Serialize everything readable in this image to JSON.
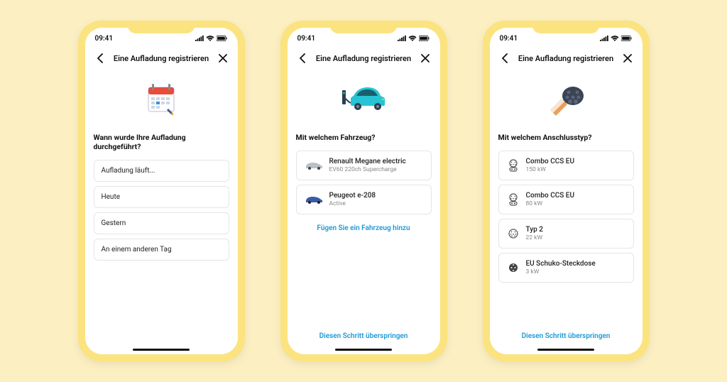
{
  "status": {
    "time": "09:41"
  },
  "nav": {
    "title": "Eine Aufladung registrieren"
  },
  "screen1": {
    "question": "Wann wurde Ihre Aufladung durchgeführt?",
    "options": [
      "Aufladung läuft...",
      "Heute",
      "Gestern",
      "An einem anderen Tag"
    ]
  },
  "screen2": {
    "question": "Mit welchem Fahrzeug?",
    "vehicles": [
      {
        "name": "Renault Megane electric",
        "sub": "EV60 220ch Supercharge"
      },
      {
        "name": "Peugeot e-208",
        "sub": "Active"
      }
    ],
    "add_link": "Fügen Sie ein Fahrzeug hinzu",
    "skip": "Diesen Schritt überspringen"
  },
  "screen3": {
    "question": "Mit welchem Anschlusstyp?",
    "connectors": [
      {
        "name": "Combo CCS EU",
        "sub": "150 kW"
      },
      {
        "name": "Combo CCS EU",
        "sub": "80 kW"
      },
      {
        "name": "Typ 2",
        "sub": "22 kW"
      },
      {
        "name": "EU Schuko-Steckdose",
        "sub": "3 kW"
      }
    ],
    "skip": "Diesen Schritt überspringen"
  }
}
